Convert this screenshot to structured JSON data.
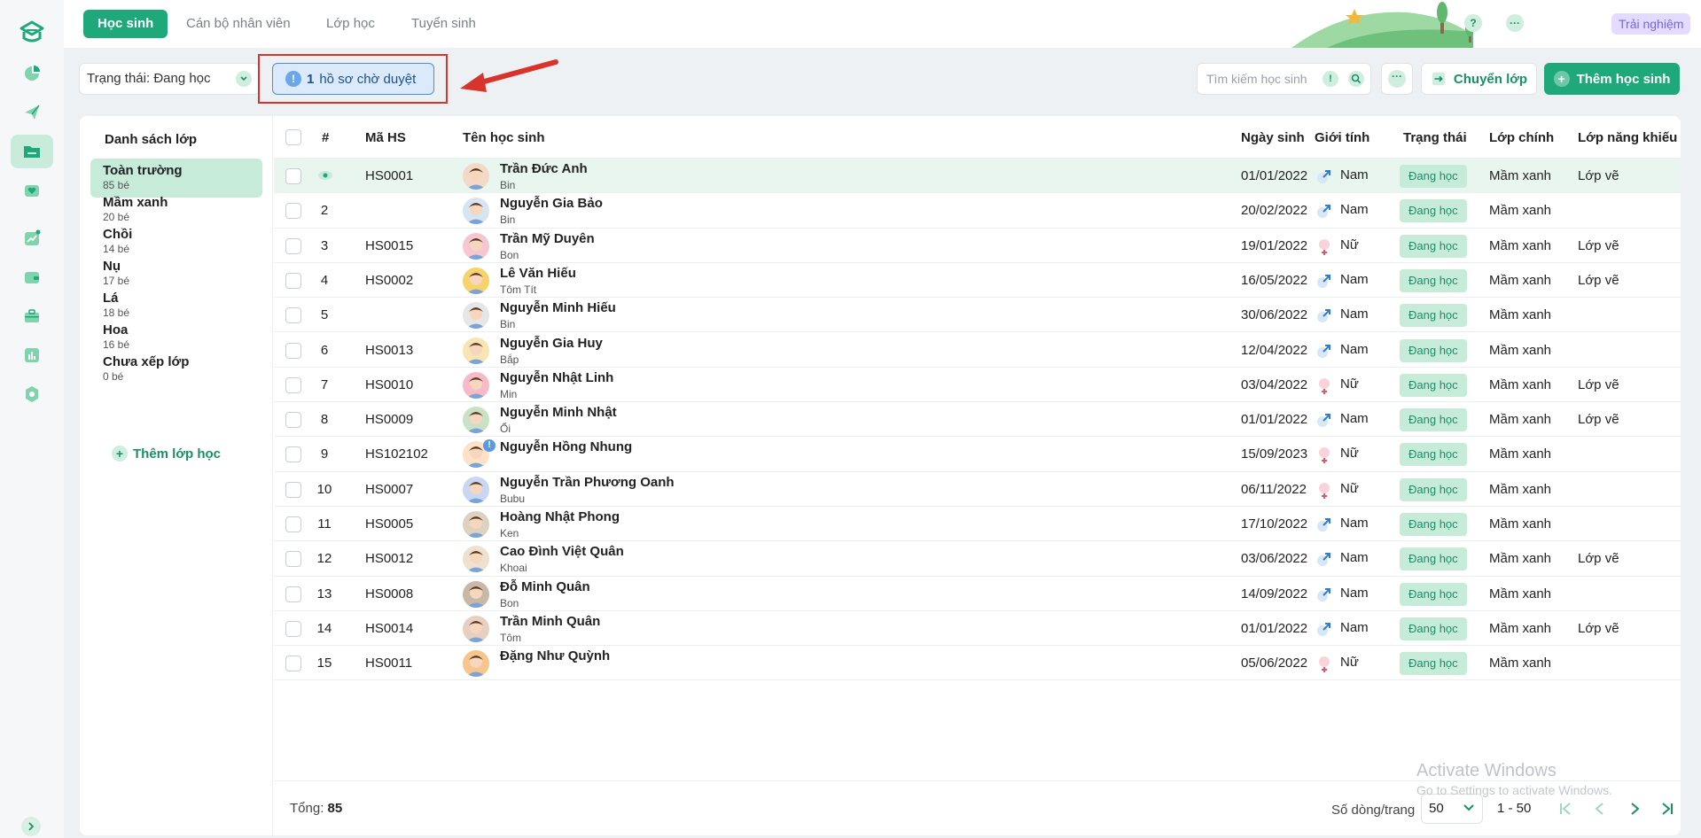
{
  "colors": {
    "brand": "#1fa97a",
    "brand_light": "#c6ebd9",
    "pending_blue": "#dbeafa",
    "trial_purple": "#e4dcff",
    "highlight_red": "#d9342b"
  },
  "topnav": {
    "tabs": [
      {
        "label": "Học sinh",
        "active": true
      },
      {
        "label": "Cán bộ nhân viên",
        "active": false
      },
      {
        "label": "Lớp học",
        "active": false
      },
      {
        "label": "Tuyển sinh",
        "active": false
      }
    ],
    "help_icon": "?",
    "more_icon": "···",
    "trial_label": "Trải nghiệm"
  },
  "toolbar": {
    "status_select_value": "Trạng thái: Đang học",
    "pending_count": "1",
    "pending_text": "hồ sơ chờ duyệt",
    "search_placeholder": "Tìm kiếm học sinh",
    "move_class_label": "Chuyển lớp",
    "add_student_label": "Thêm học sinh"
  },
  "class_list": {
    "title": "Danh sách lớp",
    "items": [
      {
        "name": "Toàn trường",
        "count": "85 bé",
        "active": true
      },
      {
        "name": "Mầm xanh",
        "count": "20 bé",
        "active": false
      },
      {
        "name": "Chồi",
        "count": "14 bé",
        "active": false
      },
      {
        "name": "Nụ",
        "count": "17 bé",
        "active": false
      },
      {
        "name": "Lá",
        "count": "18 bé",
        "active": false
      },
      {
        "name": "Hoa",
        "count": "16 bé",
        "active": false
      },
      {
        "name": "Chưa xếp lớp",
        "count": "0 bé",
        "active": false
      }
    ],
    "add_label": "Thêm lớp học"
  },
  "table": {
    "headers": {
      "num": "#",
      "code": "Mã HS",
      "name": "Tên học sinh",
      "dob": "Ngày sinh",
      "gender": "Giới tính",
      "status": "Trạng thái",
      "main_class": "Lớp chính",
      "talent_class": "Lớp năng khiếu"
    },
    "rows": [
      {
        "num": "",
        "code": "HS0001",
        "name": "Trần Đức Anh",
        "nick": "Bin",
        "dob": "01/01/2022",
        "gender": "Nam",
        "status": "Đang học",
        "main": "Mầm xanh",
        "talent": "Lớp vẽ",
        "selected": true
      },
      {
        "num": "2",
        "code": "",
        "name": "Nguyễn Gia Bảo",
        "nick": "Bin",
        "dob": "20/02/2022",
        "gender": "Nam",
        "status": "Đang học",
        "main": "Mầm xanh",
        "talent": ""
      },
      {
        "num": "3",
        "code": "HS0015",
        "name": "Trần Mỹ Duyên",
        "nick": "Bon",
        "dob": "19/01/2022",
        "gender": "Nữ",
        "status": "Đang học",
        "main": "Mầm xanh",
        "talent": "Lớp vẽ"
      },
      {
        "num": "4",
        "code": "HS0002",
        "name": "Lê Văn Hiếu",
        "nick": "Tôm Tít",
        "dob": "16/05/2022",
        "gender": "Nam",
        "status": "Đang học",
        "main": "Mầm xanh",
        "talent": "Lớp vẽ"
      },
      {
        "num": "5",
        "code": "",
        "name": "Nguyễn Minh Hiếu",
        "nick": "Bin",
        "dob": "30/06/2022",
        "gender": "Nam",
        "status": "Đang học",
        "main": "Mầm xanh",
        "talent": ""
      },
      {
        "num": "6",
        "code": "HS0013",
        "name": "Nguyễn Gia Huy",
        "nick": "Bắp",
        "dob": "12/04/2022",
        "gender": "Nam",
        "status": "Đang học",
        "main": "Mầm xanh",
        "talent": ""
      },
      {
        "num": "7",
        "code": "HS0010",
        "name": "Nguyễn Nhật Linh",
        "nick": "Min",
        "dob": "03/04/2022",
        "gender": "Nữ",
        "status": "Đang học",
        "main": "Mầm xanh",
        "talent": "Lớp vẽ"
      },
      {
        "num": "8",
        "code": "HS0009",
        "name": "Nguyễn Minh Nhật",
        "nick": "Ổi",
        "dob": "01/01/2022",
        "gender": "Nam",
        "status": "Đang học",
        "main": "Mầm xanh",
        "talent": "Lớp vẽ"
      },
      {
        "num": "9",
        "code": "HS102102",
        "name": "Nguyễn Hồng Nhung",
        "nick": "",
        "dob": "15/09/2023",
        "gender": "Nữ",
        "status": "Đang học",
        "main": "Mầm xanh",
        "talent": "",
        "notif": "!"
      },
      {
        "num": "10",
        "code": "HS0007",
        "name": "Nguyễn Trần Phương Oanh",
        "nick": "Bubu",
        "dob": "06/11/2022",
        "gender": "Nữ",
        "status": "Đang học",
        "main": "Mầm xanh",
        "talent": ""
      },
      {
        "num": "11",
        "code": "HS0005",
        "name": "Hoàng Nhật Phong",
        "nick": "Ken",
        "dob": "17/10/2022",
        "gender": "Nam",
        "status": "Đang học",
        "main": "Mầm xanh",
        "talent": ""
      },
      {
        "num": "12",
        "code": "HS0012",
        "name": "Cao Đình Việt Quân",
        "nick": "Khoai",
        "dob": "03/06/2022",
        "gender": "Nam",
        "status": "Đang học",
        "main": "Mầm xanh",
        "talent": "Lớp vẽ"
      },
      {
        "num": "13",
        "code": "HS0008",
        "name": "Đỗ Minh Quân",
        "nick": "Bon",
        "dob": "14/09/2022",
        "gender": "Nam",
        "status": "Đang học",
        "main": "Mầm xanh",
        "talent": ""
      },
      {
        "num": "14",
        "code": "HS0014",
        "name": "Trần Minh Quân",
        "nick": "Tôm",
        "dob": "01/01/2022",
        "gender": "Nam",
        "status": "Đang học",
        "main": "Mầm xanh",
        "talent": "Lớp vẽ"
      },
      {
        "num": "15",
        "code": "HS0011",
        "name": "Đặng Như Quỳnh",
        "nick": "",
        "dob": "05/06/2022",
        "gender": "Nữ",
        "status": "Đang học",
        "main": "Mầm xanh",
        "talent": ""
      }
    ]
  },
  "footer": {
    "total_label": "Tổng:",
    "total_value": "85",
    "per_page_label": "Số dòng/trang",
    "per_page_value": "50",
    "range": "1 - 50"
  },
  "watermark": {
    "line1": "Activate Windows",
    "line2": "Go to Settings to activate Windows."
  }
}
